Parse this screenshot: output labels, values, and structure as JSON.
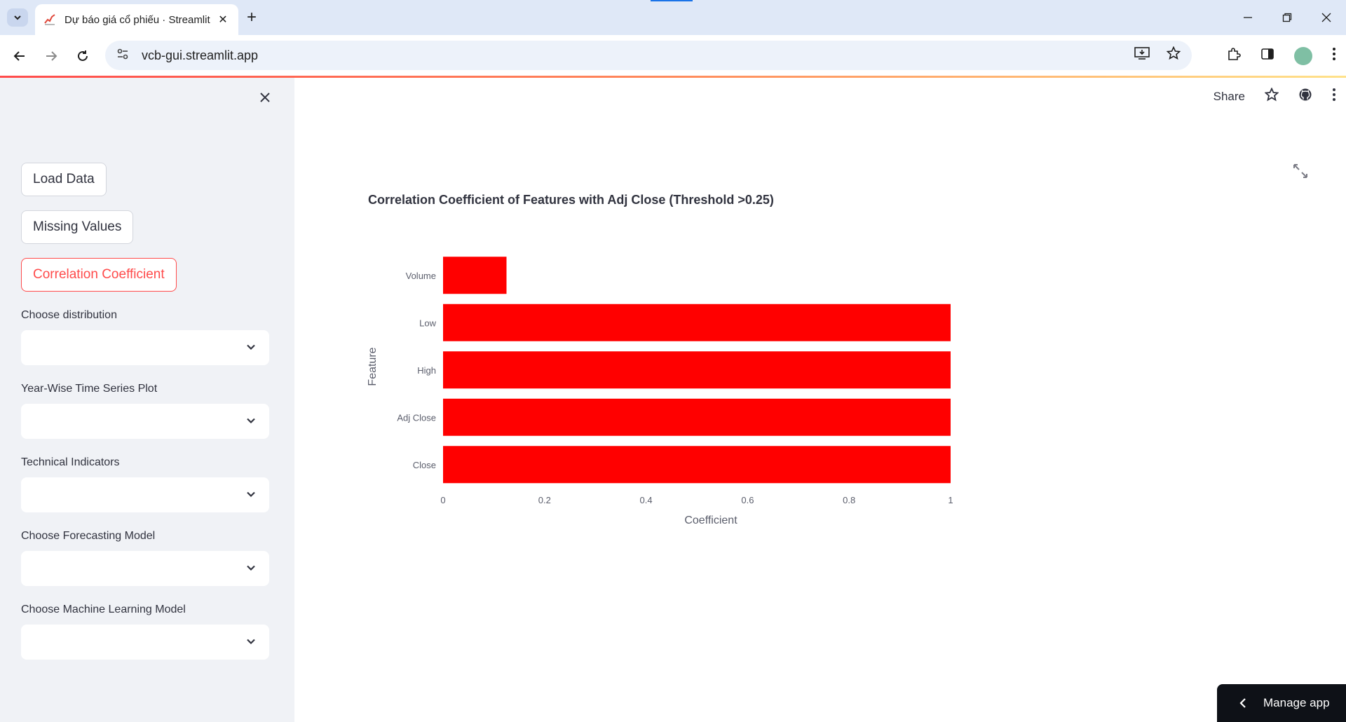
{
  "browser": {
    "tab_title": "Dự báo giá cổ phiếu · Streamlit",
    "url": "vcb-gui.streamlit.app"
  },
  "sidebar": {
    "buttons": [
      {
        "label": "Load Data",
        "active": false
      },
      {
        "label": "Missing Values",
        "active": false
      },
      {
        "label": "Correlation Coefficient",
        "active": true
      }
    ],
    "selects": [
      {
        "label": "Choose distribution",
        "value": ""
      },
      {
        "label": "Year-Wise Time Series Plot",
        "value": ""
      },
      {
        "label": "Technical Indicators",
        "value": ""
      },
      {
        "label": "Choose Forecasting Model",
        "value": ""
      },
      {
        "label": "Choose Machine Learning Model",
        "value": ""
      }
    ]
  },
  "app_toolbar": {
    "share_label": "Share"
  },
  "manage_app": {
    "label": "Manage app"
  },
  "chart_data": {
    "type": "bar",
    "orientation": "horizontal",
    "title": "Correlation Coefficient of Features with Adj Close (Threshold >0.25)",
    "xlabel": "Coefficient",
    "ylabel": "Feature",
    "categories": [
      "Volume",
      "Low",
      "High",
      "Adj Close",
      "Close"
    ],
    "values": [
      0.125,
      1.0,
      1.0,
      1.0,
      1.0
    ],
    "xlim": [
      0,
      1
    ],
    "xticks": [
      "0",
      "0.2",
      "0.4",
      "0.6",
      "0.8",
      "1"
    ],
    "bar_color": "#ff0000",
    "grid": false
  }
}
